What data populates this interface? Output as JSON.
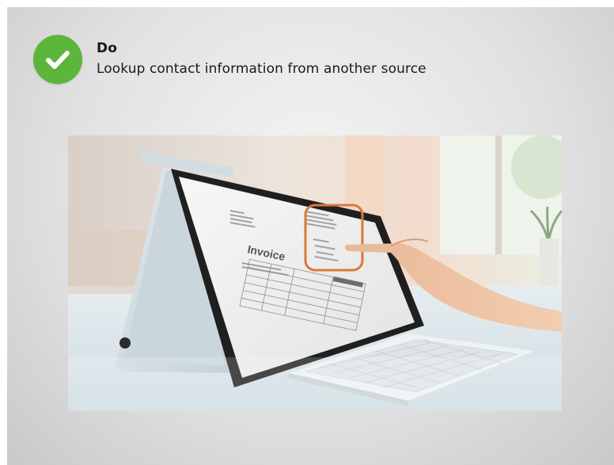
{
  "slide": {
    "heading": "Do",
    "subheading": "Lookup contact information from another source",
    "accent_color": "#5cb63b",
    "highlight_color": "#d9793a"
  },
  "icons": {
    "badge": "checkmark-icon"
  },
  "photo": {
    "subject": "laptop-invoice-photo",
    "document_heading": "Invoice"
  }
}
